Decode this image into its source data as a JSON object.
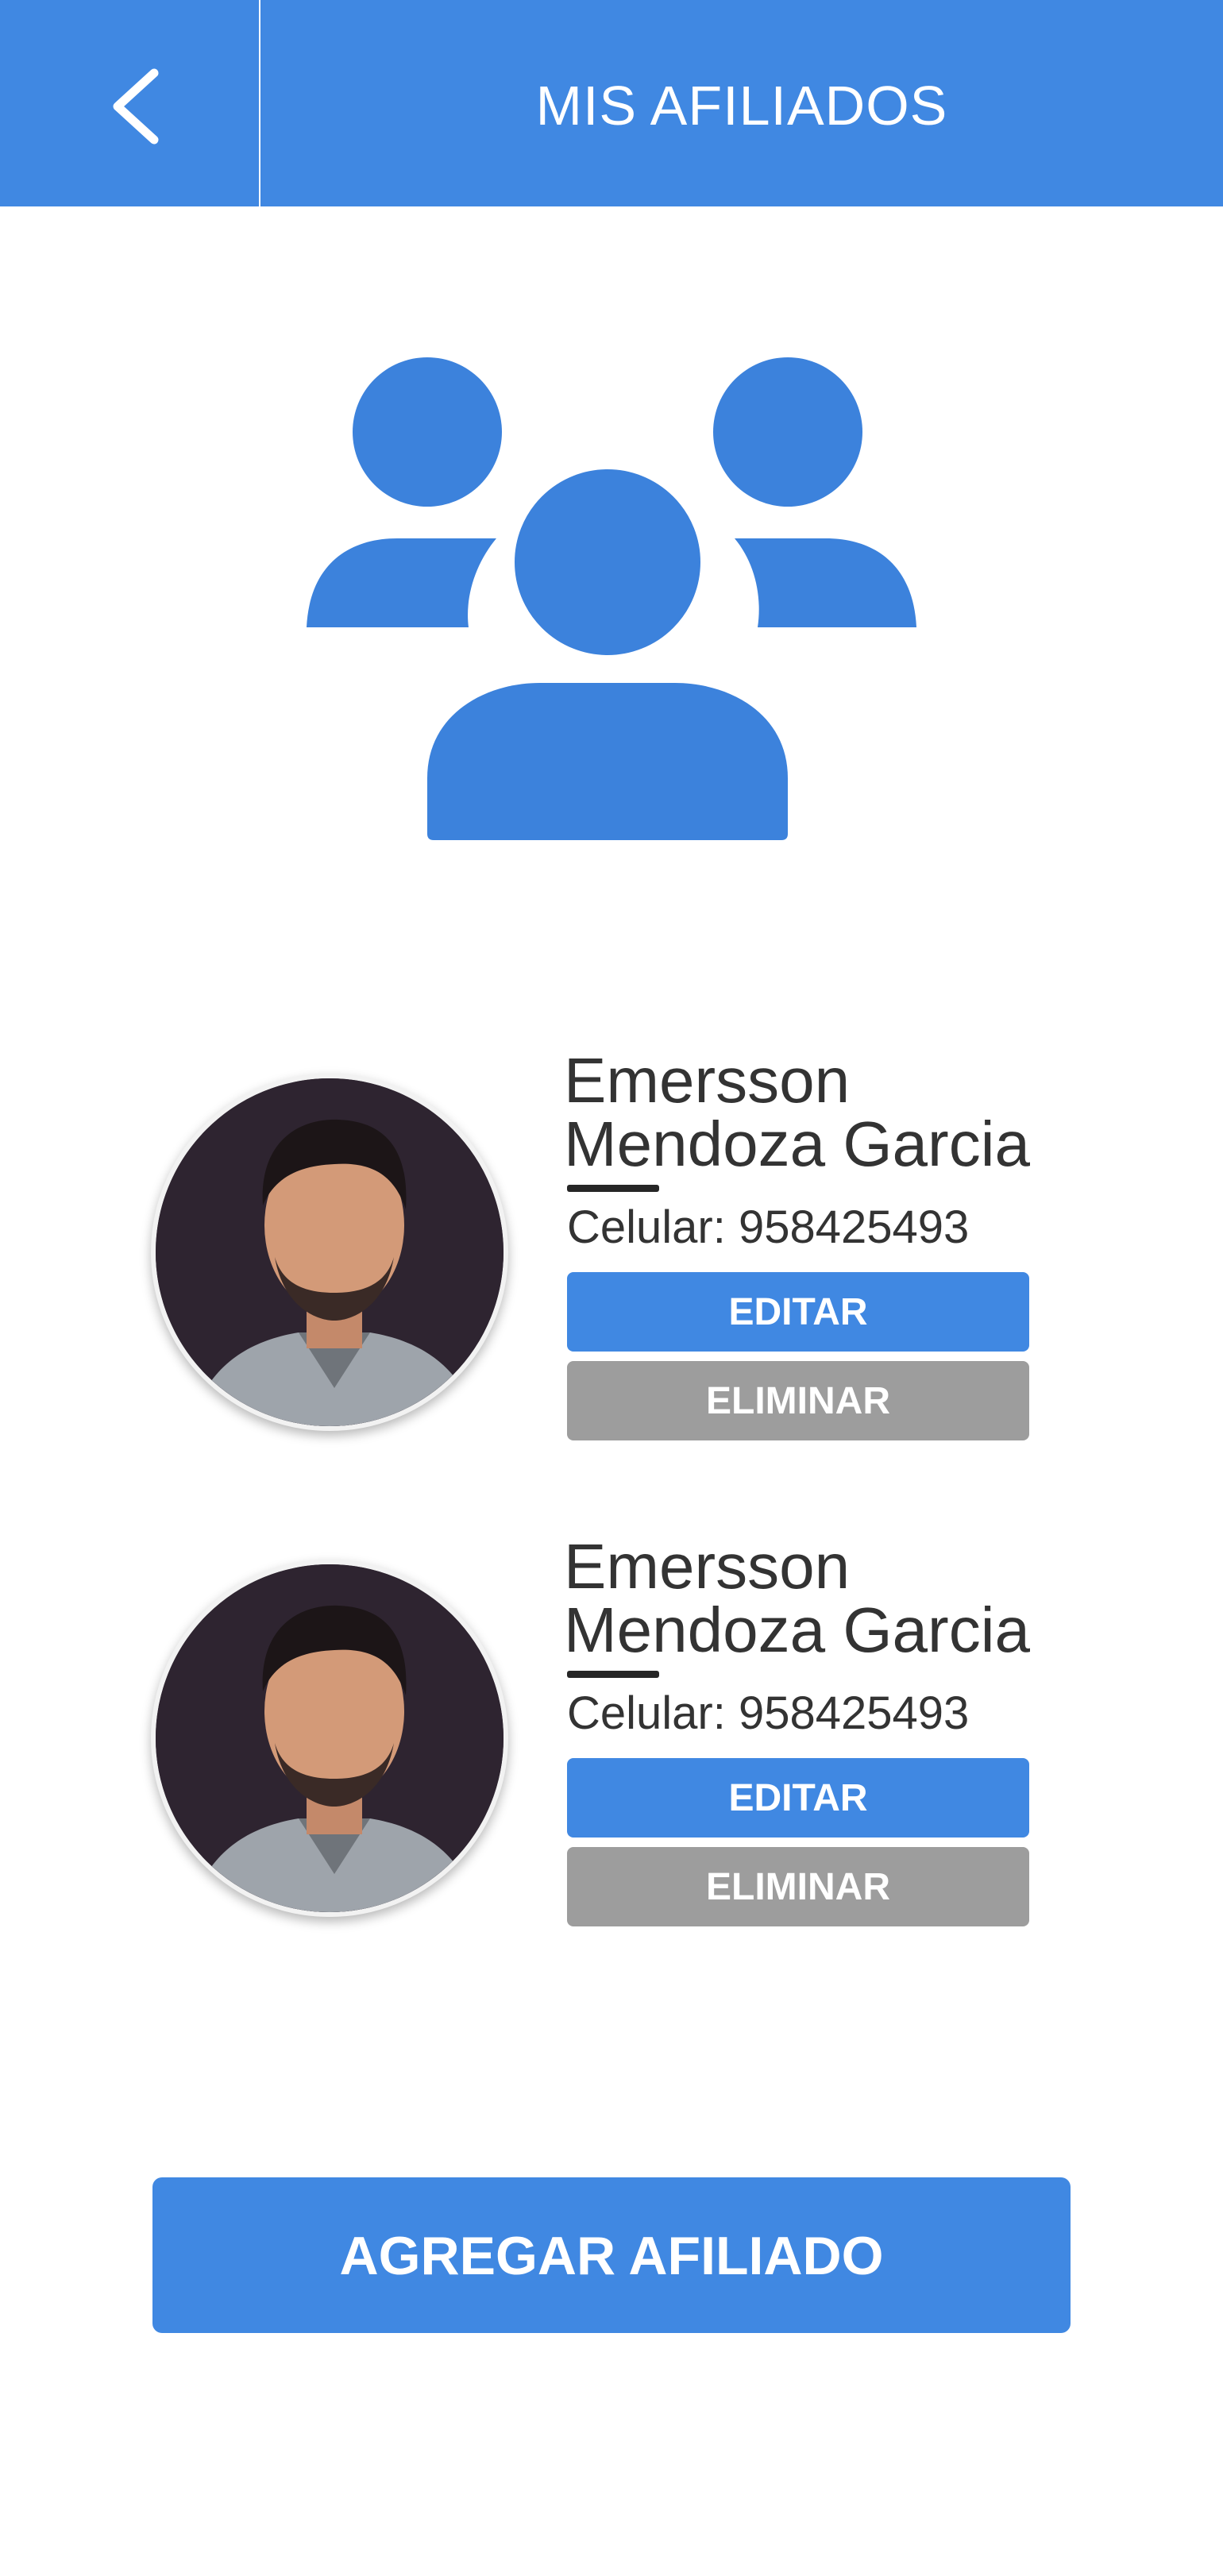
{
  "header": {
    "title": "MIS AFILIADOS",
    "back_icon": "chevron-left-icon"
  },
  "illustration": {
    "icon": "group-users-icon",
    "color": "#3c82dc"
  },
  "affiliates": [
    {
      "first_name": "Emersson",
      "last_name": "Mendoza Garcia",
      "phone": "Celular: 958425493",
      "edit_label": "EDITAR",
      "delete_label": "ELIMINAR"
    },
    {
      "first_name": "Emersson",
      "last_name": "Mendoza Garcia",
      "phone": "Celular: 958425493",
      "edit_label": "EDITAR",
      "delete_label": "ELIMINAR"
    }
  ],
  "add_button": {
    "label": "AGREGAR AFILIADO"
  },
  "colors": {
    "primary": "#4088e2",
    "secondary": "#9d9d9d",
    "text": "#333333"
  }
}
